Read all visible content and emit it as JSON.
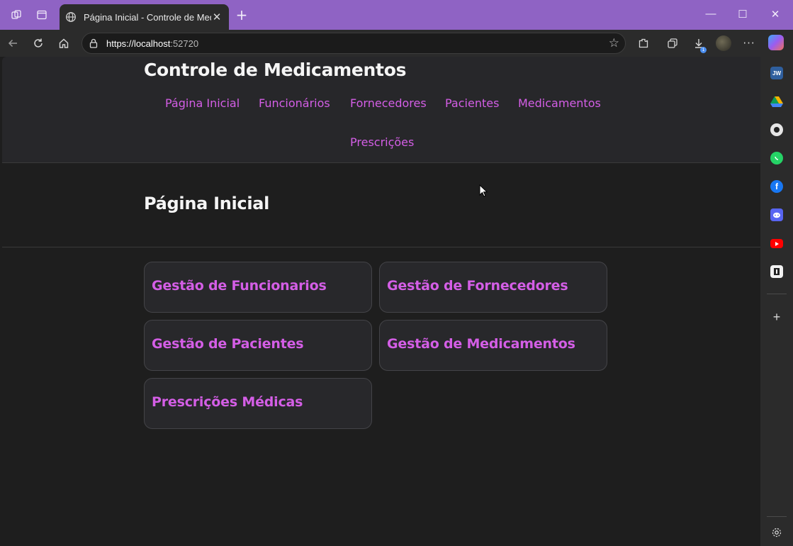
{
  "browser": {
    "tab_title": "Página Inicial - Controle de Medicamentos",
    "tab_close": "✕",
    "new_tab": "+",
    "url_host": "https://localhost",
    "url_port": ":52720",
    "download_badge": "1",
    "window_controls": {
      "minimize": "—",
      "maximize": "☐",
      "close": "✕"
    },
    "sidebar_labels": {
      "jw": "JW"
    }
  },
  "site": {
    "brand": "Controle de Medicamentos",
    "nav": [
      {
        "label": "Página Inicial"
      },
      {
        "label": "Funcionários"
      },
      {
        "label": "Fornecedores"
      },
      {
        "label": "Pacientes"
      },
      {
        "label": "Medicamentos"
      },
      {
        "label": "Prescrições"
      }
    ],
    "page_title": "Página Inicial",
    "cards": [
      {
        "label": "Gestão de Funcionarios"
      },
      {
        "label": "Gestão de Fornecedores"
      },
      {
        "label": "Gestão de Pacientes"
      },
      {
        "label": "Gestão de Medicamentos"
      },
      {
        "label": "Prescrições Médicas"
      }
    ]
  },
  "colors": {
    "accent": "#d45ee6",
    "titlebar": "#8f63c4",
    "page_bg": "#1e1e1e",
    "header_bg": "#27272a"
  }
}
